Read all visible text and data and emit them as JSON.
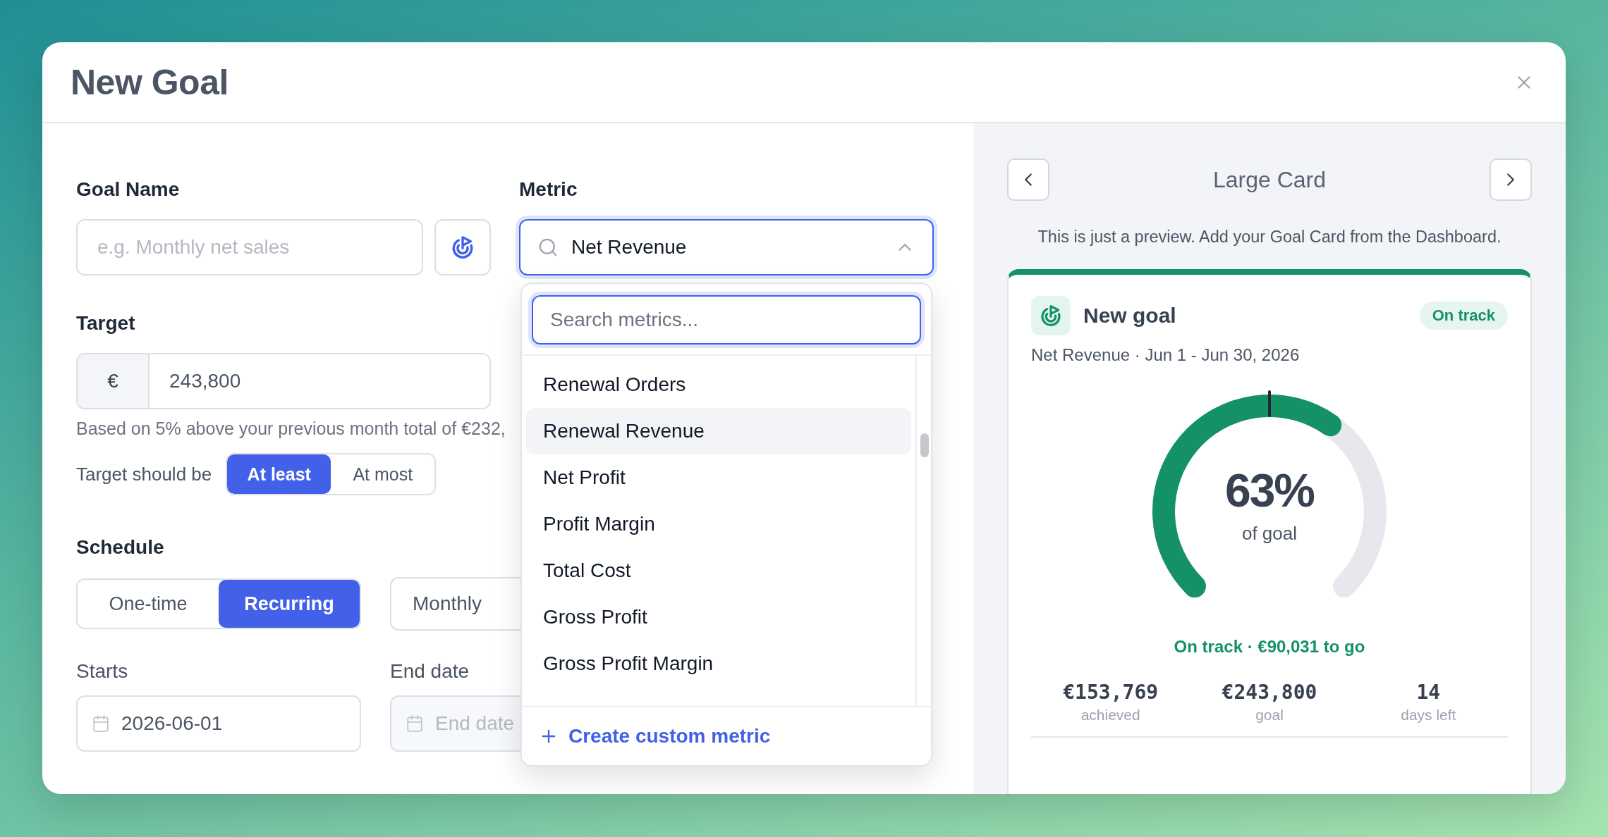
{
  "dialog": {
    "title": "New Goal"
  },
  "form": {
    "goal_name": {
      "label": "Goal Name",
      "placeholder": "e.g. Monthly net sales"
    },
    "metric": {
      "label": "Metric",
      "value": "Net Revenue",
      "expanded": true
    },
    "metric_menu": {
      "search_placeholder": "Search metrics...",
      "items": [
        {
          "label": "Renewal Orders",
          "selected": false
        },
        {
          "label": "Renewal Revenue",
          "selected": true
        },
        {
          "label": "Net Profit",
          "selected": false
        },
        {
          "label": "Profit Margin",
          "selected": false
        },
        {
          "label": "Total Cost",
          "selected": false
        },
        {
          "label": "Gross Profit",
          "selected": false
        },
        {
          "label": "Gross Profit Margin",
          "selected": false
        }
      ],
      "create_label": "Create custom metric"
    },
    "target": {
      "label": "Target",
      "currency": "€",
      "value": "243,800",
      "hint": "Based on 5% above your previous month total of €232,"
    },
    "direction": {
      "label": "Target should be",
      "options": [
        {
          "label": "At least",
          "selected": true
        },
        {
          "label": "At most",
          "selected": false
        }
      ]
    },
    "schedule": {
      "label": "Schedule",
      "options": [
        {
          "label": "One-time",
          "selected": false
        },
        {
          "label": "Recurring",
          "selected": true
        }
      ],
      "frequency": "Monthly"
    },
    "starts": {
      "label": "Starts",
      "value": "2026-06-01"
    },
    "end_date": {
      "label": "End date",
      "placeholder": "End date"
    }
  },
  "preview": {
    "title": "Large Card",
    "note": "This is just a preview. Add your Goal Card from the Dashboard.",
    "card": {
      "title": "New goal",
      "badge": "On track",
      "subtitle": "Net Revenue · Jun 1 - Jun 30, 2026",
      "gauge": {
        "percent": "63%",
        "caption": "of goal"
      },
      "status": "On track · €90,031 to go",
      "stats": [
        {
          "value": "€153,769",
          "label": "achieved"
        },
        {
          "value": "€243,800",
          "label": "goal"
        },
        {
          "value": "14",
          "label": "days left"
        }
      ]
    }
  }
}
